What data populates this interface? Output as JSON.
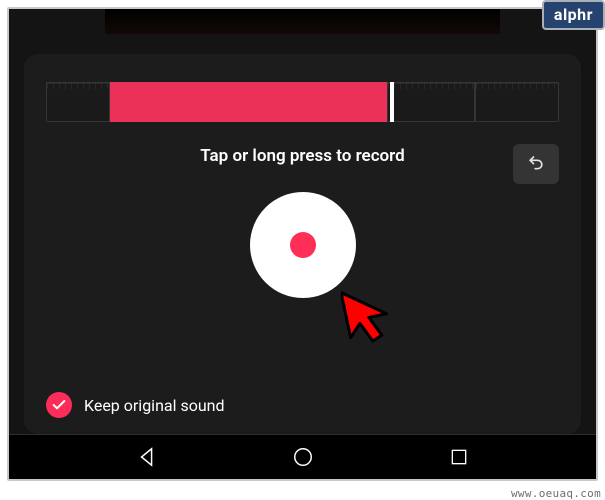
{
  "badge": {
    "text": "alphr"
  },
  "panel": {
    "instruction": "Tap or long press to record",
    "keep_sound_label": "Keep original sound"
  },
  "watermark": "www.oeuaq.com"
}
